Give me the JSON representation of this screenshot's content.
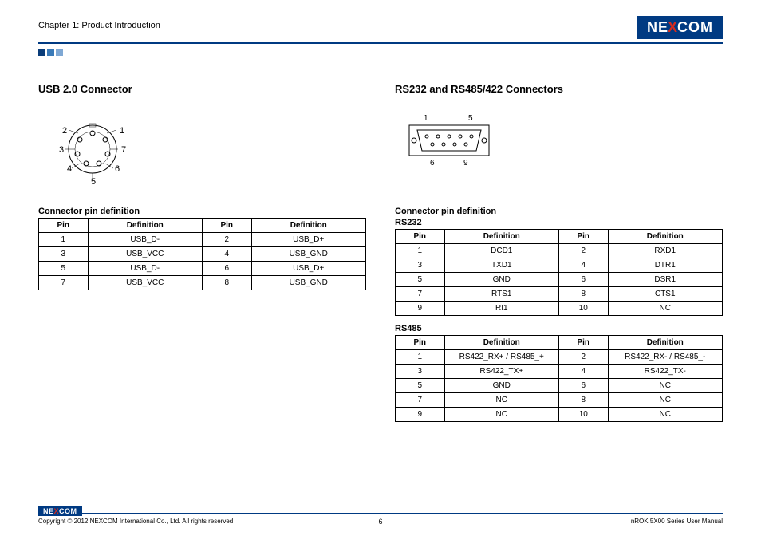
{
  "header": {
    "chapter": "Chapter 1: Product Introduction",
    "logo": {
      "pre": "NE",
      "x": "X",
      "post": "COM"
    }
  },
  "left": {
    "title": "USB 2.0 Connector",
    "diagram_labels": [
      "1",
      "2",
      "3",
      "4",
      "5",
      "6",
      "7"
    ],
    "subheading": "Connector pin definition",
    "table": {
      "headers": [
        "Pin",
        "Definition",
        "Pin",
        "Definition"
      ],
      "rows": [
        [
          "1",
          "USB_D-",
          "2",
          "USB_D+"
        ],
        [
          "3",
          "USB_VCC",
          "4",
          "USB_GND"
        ],
        [
          "5",
          "USB_D-",
          "6",
          "USB_D+"
        ],
        [
          "7",
          "USB_VCC",
          "8",
          "USB_GND"
        ]
      ]
    }
  },
  "right": {
    "title": "RS232 and RS485/422 Connectors",
    "diagram_labels": [
      "1",
      "5",
      "6",
      "9"
    ],
    "subheading": "Connector pin definition",
    "rs232": {
      "label": "RS232",
      "headers": [
        "Pin",
        "Definition",
        "Pin",
        "Definition"
      ],
      "rows": [
        [
          "1",
          "DCD1",
          "2",
          "RXD1"
        ],
        [
          "3",
          "TXD1",
          "4",
          "DTR1"
        ],
        [
          "5",
          "GND",
          "6",
          "DSR1"
        ],
        [
          "7",
          "RTS1",
          "8",
          "CTS1"
        ],
        [
          "9",
          "RI1",
          "10",
          "NC"
        ]
      ]
    },
    "rs485": {
      "label": "RS485",
      "headers": [
        "Pin",
        "Definition",
        "Pin",
        "Definition"
      ],
      "rows": [
        [
          "1",
          "RS422_RX+ / RS485_+",
          "2",
          "RS422_RX- / RS485_-"
        ],
        [
          "3",
          "RS422_TX+",
          "4",
          "RS422_TX-"
        ],
        [
          "5",
          "GND",
          "6",
          "NC"
        ],
        [
          "7",
          "NC",
          "8",
          "NC"
        ],
        [
          "9",
          "NC",
          "10",
          "NC"
        ]
      ]
    }
  },
  "footer": {
    "copyright": "Copyright © 2012 NEXCOM International Co., Ltd. All rights reserved",
    "page": "6",
    "manual": "nROK 5X00 Series User Manual",
    "logo": {
      "pre": "NE",
      "x": "X",
      "post": "COM"
    }
  }
}
